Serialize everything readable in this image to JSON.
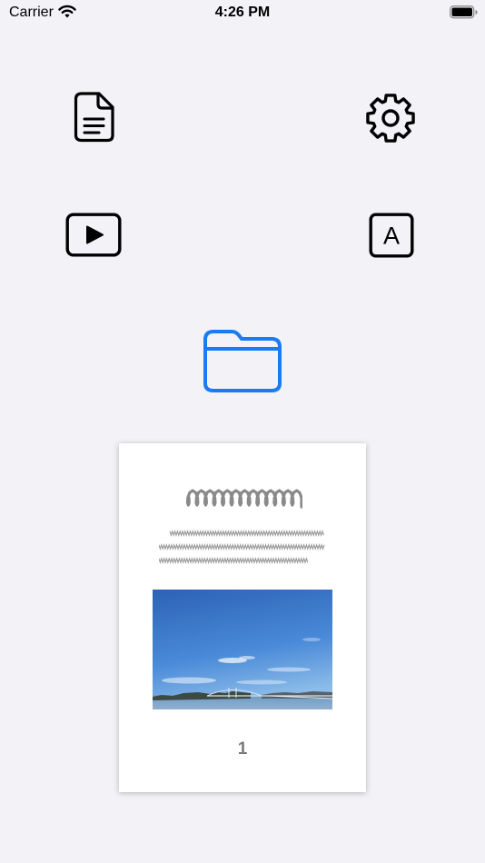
{
  "status_bar": {
    "carrier": "Carrier",
    "time": "4:26 PM"
  },
  "toolbar": {
    "items": [
      {
        "icon": "document-icon"
      },
      {
        "icon": "gear-icon"
      },
      {
        "icon": "play-icon"
      },
      {
        "icon": "font-icon",
        "glyph": "A"
      },
      {
        "icon": "folder-icon"
      }
    ]
  },
  "page_preview": {
    "page_number": "1"
  },
  "colors": {
    "background": "#f2f2f7",
    "accent": "#1a7cf5",
    "icon": "#000000",
    "page_number": "#7a7a7a"
  }
}
